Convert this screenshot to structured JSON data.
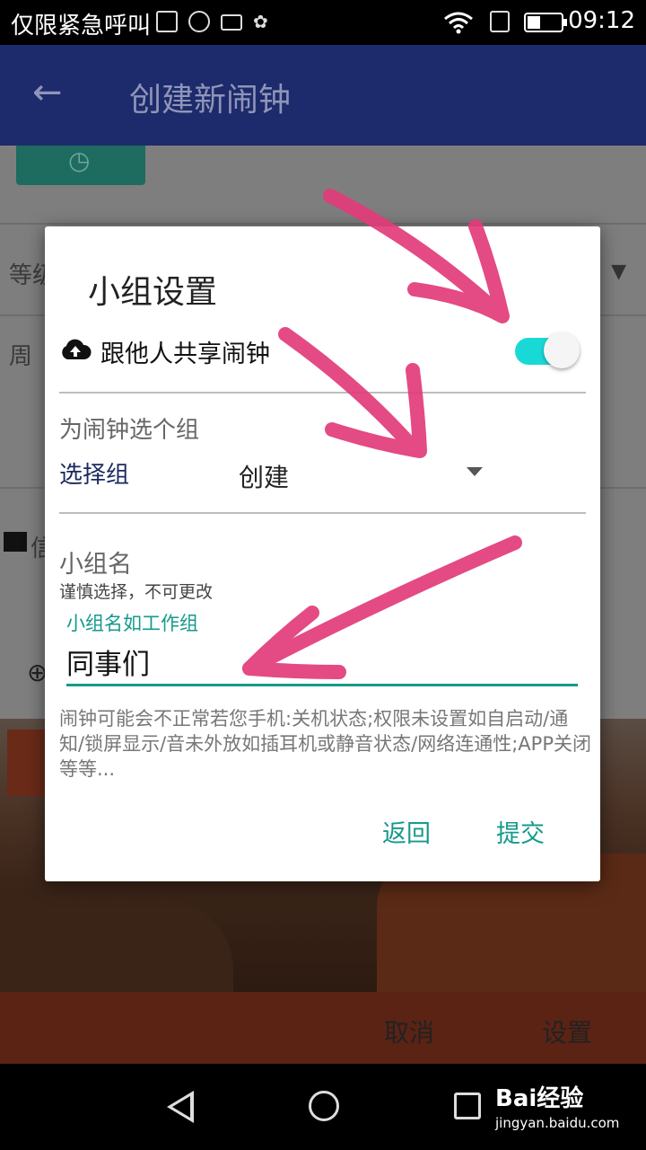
{
  "status_bar": {
    "carrier": "仅限紧急呼叫",
    "time": "09:12"
  },
  "app_bar": {
    "back_icon": "arrow-left-icon",
    "title": "创建新闹钟"
  },
  "background_form": {
    "level_label_partial": "等级",
    "week_label": "周",
    "info_label_partial": "信"
  },
  "dialog": {
    "title": "小组设置",
    "share": {
      "icon": "cloud-upload-icon",
      "label": "跟他人共享闹钟",
      "enabled": true,
      "accent_color": "#19d9d7"
    },
    "group_select": {
      "prompt": "为闹钟选个组",
      "label": "选择组",
      "value": "创建"
    },
    "group_name": {
      "label": "小组名",
      "hint": "谨慎选择，不可更改",
      "placeholder": "小组名如工作组",
      "value": "同事们",
      "accent_color": "#159a8c"
    },
    "notice": "闹钟可能会不正常若您手机:关机状态;权限未设置如自启动/通知/锁屏显示/音未外放如插耳机或静音状态/网络连通性;APP关闭等等...",
    "buttons": {
      "back": "返回",
      "submit": "提交"
    }
  },
  "action_bar": {
    "cancel": "取消",
    "confirm": "设置"
  },
  "watermark": {
    "brand": "Bai经验",
    "url": "jingyan.baidu.com"
  },
  "annotation_color": "#e23b7a"
}
